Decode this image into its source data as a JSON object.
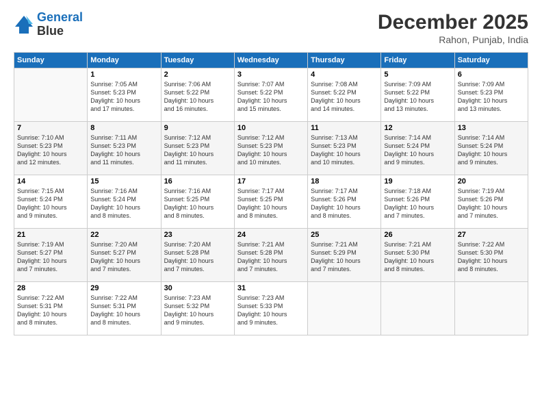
{
  "header": {
    "logo_line1": "General",
    "logo_line2": "Blue",
    "month": "December 2025",
    "location": "Rahon, Punjab, India"
  },
  "weekdays": [
    "Sunday",
    "Monday",
    "Tuesday",
    "Wednesday",
    "Thursday",
    "Friday",
    "Saturday"
  ],
  "weeks": [
    [
      {
        "day": "",
        "info": ""
      },
      {
        "day": "1",
        "info": "Sunrise: 7:05 AM\nSunset: 5:23 PM\nDaylight: 10 hours\nand 17 minutes."
      },
      {
        "day": "2",
        "info": "Sunrise: 7:06 AM\nSunset: 5:22 PM\nDaylight: 10 hours\nand 16 minutes."
      },
      {
        "day": "3",
        "info": "Sunrise: 7:07 AM\nSunset: 5:22 PM\nDaylight: 10 hours\nand 15 minutes."
      },
      {
        "day": "4",
        "info": "Sunrise: 7:08 AM\nSunset: 5:22 PM\nDaylight: 10 hours\nand 14 minutes."
      },
      {
        "day": "5",
        "info": "Sunrise: 7:09 AM\nSunset: 5:22 PM\nDaylight: 10 hours\nand 13 minutes."
      },
      {
        "day": "6",
        "info": "Sunrise: 7:09 AM\nSunset: 5:23 PM\nDaylight: 10 hours\nand 13 minutes."
      }
    ],
    [
      {
        "day": "7",
        "info": "Sunrise: 7:10 AM\nSunset: 5:23 PM\nDaylight: 10 hours\nand 12 minutes."
      },
      {
        "day": "8",
        "info": "Sunrise: 7:11 AM\nSunset: 5:23 PM\nDaylight: 10 hours\nand 11 minutes."
      },
      {
        "day": "9",
        "info": "Sunrise: 7:12 AM\nSunset: 5:23 PM\nDaylight: 10 hours\nand 11 minutes."
      },
      {
        "day": "10",
        "info": "Sunrise: 7:12 AM\nSunset: 5:23 PM\nDaylight: 10 hours\nand 10 minutes."
      },
      {
        "day": "11",
        "info": "Sunrise: 7:13 AM\nSunset: 5:23 PM\nDaylight: 10 hours\nand 10 minutes."
      },
      {
        "day": "12",
        "info": "Sunrise: 7:14 AM\nSunset: 5:24 PM\nDaylight: 10 hours\nand 9 minutes."
      },
      {
        "day": "13",
        "info": "Sunrise: 7:14 AM\nSunset: 5:24 PM\nDaylight: 10 hours\nand 9 minutes."
      }
    ],
    [
      {
        "day": "14",
        "info": "Sunrise: 7:15 AM\nSunset: 5:24 PM\nDaylight: 10 hours\nand 9 minutes."
      },
      {
        "day": "15",
        "info": "Sunrise: 7:16 AM\nSunset: 5:24 PM\nDaylight: 10 hours\nand 8 minutes."
      },
      {
        "day": "16",
        "info": "Sunrise: 7:16 AM\nSunset: 5:25 PM\nDaylight: 10 hours\nand 8 minutes."
      },
      {
        "day": "17",
        "info": "Sunrise: 7:17 AM\nSunset: 5:25 PM\nDaylight: 10 hours\nand 8 minutes."
      },
      {
        "day": "18",
        "info": "Sunrise: 7:17 AM\nSunset: 5:26 PM\nDaylight: 10 hours\nand 8 minutes."
      },
      {
        "day": "19",
        "info": "Sunrise: 7:18 AM\nSunset: 5:26 PM\nDaylight: 10 hours\nand 7 minutes."
      },
      {
        "day": "20",
        "info": "Sunrise: 7:19 AM\nSunset: 5:26 PM\nDaylight: 10 hours\nand 7 minutes."
      }
    ],
    [
      {
        "day": "21",
        "info": "Sunrise: 7:19 AM\nSunset: 5:27 PM\nDaylight: 10 hours\nand 7 minutes."
      },
      {
        "day": "22",
        "info": "Sunrise: 7:20 AM\nSunset: 5:27 PM\nDaylight: 10 hours\nand 7 minutes."
      },
      {
        "day": "23",
        "info": "Sunrise: 7:20 AM\nSunset: 5:28 PM\nDaylight: 10 hours\nand 7 minutes."
      },
      {
        "day": "24",
        "info": "Sunrise: 7:21 AM\nSunset: 5:28 PM\nDaylight: 10 hours\nand 7 minutes."
      },
      {
        "day": "25",
        "info": "Sunrise: 7:21 AM\nSunset: 5:29 PM\nDaylight: 10 hours\nand 7 minutes."
      },
      {
        "day": "26",
        "info": "Sunrise: 7:21 AM\nSunset: 5:30 PM\nDaylight: 10 hours\nand 8 minutes."
      },
      {
        "day": "27",
        "info": "Sunrise: 7:22 AM\nSunset: 5:30 PM\nDaylight: 10 hours\nand 8 minutes."
      }
    ],
    [
      {
        "day": "28",
        "info": "Sunrise: 7:22 AM\nSunset: 5:31 PM\nDaylight: 10 hours\nand 8 minutes."
      },
      {
        "day": "29",
        "info": "Sunrise: 7:22 AM\nSunset: 5:31 PM\nDaylight: 10 hours\nand 8 minutes."
      },
      {
        "day": "30",
        "info": "Sunrise: 7:23 AM\nSunset: 5:32 PM\nDaylight: 10 hours\nand 9 minutes."
      },
      {
        "day": "31",
        "info": "Sunrise: 7:23 AM\nSunset: 5:33 PM\nDaylight: 10 hours\nand 9 minutes."
      },
      {
        "day": "",
        "info": ""
      },
      {
        "day": "",
        "info": ""
      },
      {
        "day": "",
        "info": ""
      }
    ]
  ]
}
